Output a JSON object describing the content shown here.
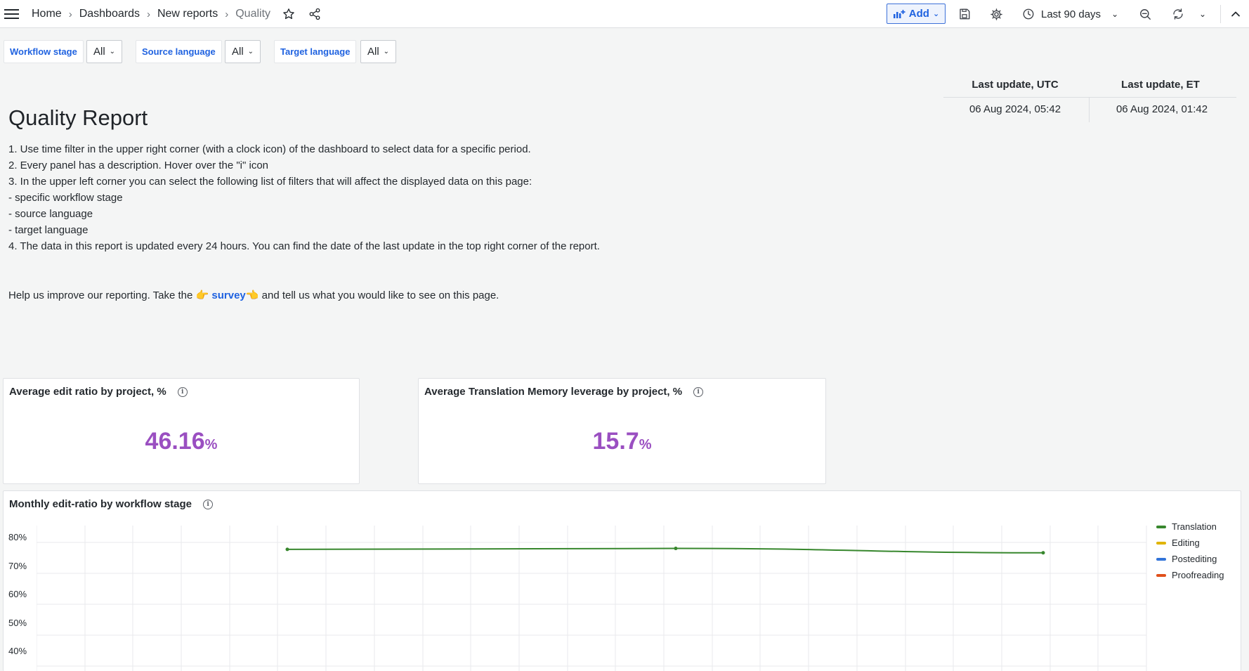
{
  "breadcrumb": [
    "Home",
    "Dashboards",
    "New reports",
    "Quality"
  ],
  "toolbar": {
    "add_label": "Add",
    "time_range": "Last 90 days"
  },
  "filters": [
    {
      "label": "Workflow stage",
      "value": "All"
    },
    {
      "label": "Source language",
      "value": "All"
    },
    {
      "label": "Target language",
      "value": "All"
    }
  ],
  "last_update": {
    "headers": [
      "Last update, UTC",
      "Last update, ET"
    ],
    "values": [
      "06 Aug 2024, 05:42",
      "06 Aug 2024, 01:42"
    ]
  },
  "report": {
    "title": "Quality Report",
    "instructions": [
      "1. Use time filter in the upper right corner (with a clock icon) of the dashboard to select data for a specific period.",
      "2. Every panel has a description. Hover over the \"i\" icon",
      "3. In the upper left corner you can select the following list of filters that will affect the displayed data on this page:",
      "- specific workflow stage",
      "- source language",
      "- target language",
      "4. The data in this report is updated every 24 hours. You can find the date of the last update in the top right corner of the report."
    ],
    "survey_prefix": "Help us improve our reporting. Take the",
    "survey_emoji_left": "👉",
    "survey_link": "survey",
    "survey_emoji_right": "👈",
    "survey_suffix": "and tell us what you would like to see on this page."
  },
  "stats": [
    {
      "title": "Average edit ratio by project, %",
      "value": "46.16",
      "unit": "%"
    },
    {
      "title": "Average Translation Memory leverage by project, %",
      "value": "15.7",
      "unit": "%"
    }
  ],
  "chart_panel": {
    "title": "Monthly edit-ratio by workflow stage"
  },
  "chart_data": {
    "type": "line",
    "title": "Monthly edit-ratio by workflow stage",
    "y_ticks": [
      "80%",
      "70%",
      "60%",
      "50%",
      "40%"
    ],
    "ylim": [
      35,
      85
    ],
    "grid": true,
    "legend_position": "right",
    "series": [
      {
        "name": "Translation",
        "color": "#37872d",
        "points": [
          [
            0.28,
            77.3
          ],
          [
            0.65,
            77.6
          ],
          [
            1.0,
            76.2
          ]
        ]
      },
      {
        "name": "Editing",
        "color": "#e0b400",
        "points": []
      },
      {
        "name": "Postediting",
        "color": "#3274d9",
        "points": []
      },
      {
        "name": "Proofreading",
        "color": "#e0501b",
        "points": []
      }
    ]
  }
}
